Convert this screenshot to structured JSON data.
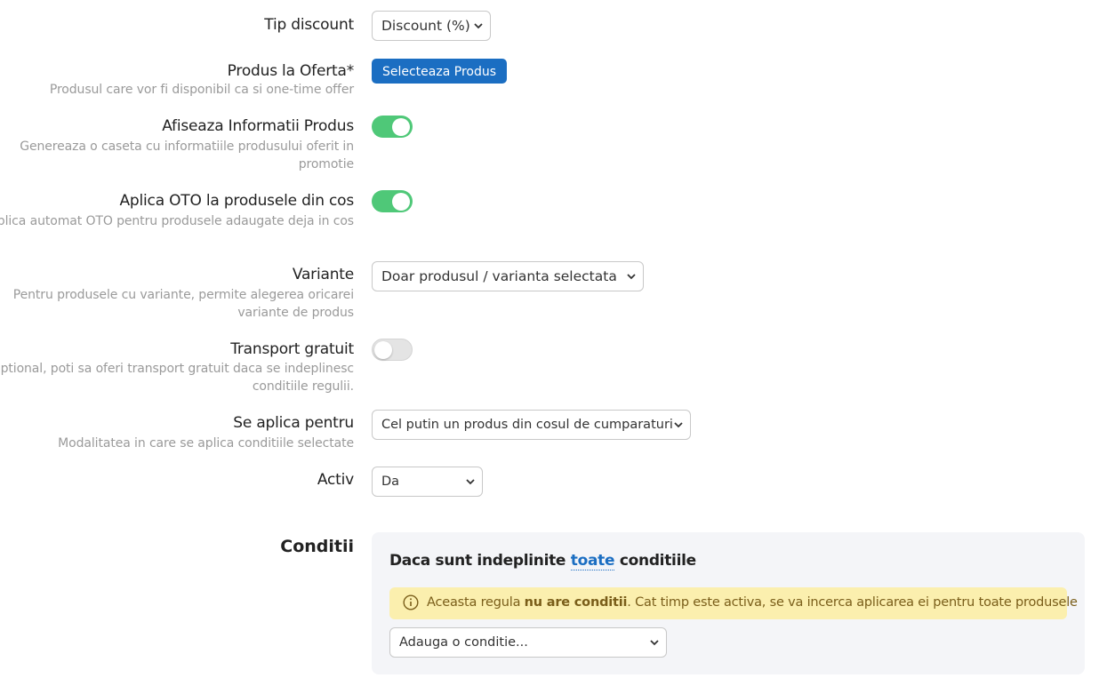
{
  "form": {
    "tip_discount": {
      "label": "Tip discount",
      "value": "Discount (%)"
    },
    "produs_oferta": {
      "label": "Produs la Oferta*",
      "help": "Produsul care vor fi disponibil ca si one-time offer",
      "button": "Selecteaza Produs"
    },
    "afiseaza_info": {
      "label": "Afiseaza Informatii Produs",
      "help": "Genereaza o caseta cu informatiile produsului oferit in promotie",
      "enabled": true
    },
    "aplica_oto": {
      "label": "Aplica OTO la produsele din cos",
      "help": "Aplica automat OTO pentru produsele adaugate deja in cos",
      "enabled": true
    },
    "variante": {
      "label": "Variante",
      "help": "Pentru produsele cu variante, permite alegerea oricarei variante de produs",
      "value": "Doar produsul / varianta selectata"
    },
    "transport": {
      "label": "Transport gratuit",
      "help": "Optional, poti sa oferi transport gratuit daca se indeplinesc conditiile regulii.",
      "enabled": false
    },
    "se_aplica": {
      "label": "Se aplica pentru",
      "help": "Modalitatea in care se aplica conditiile selectate",
      "value": "Cel putin un produs din cosul de cumparaturi"
    },
    "activ": {
      "label": "Activ",
      "value": "Da"
    }
  },
  "conditii": {
    "section_label": "Conditii",
    "title_prefix": "Daca sunt indeplinite",
    "title_link": "toate",
    "title_suffix": "conditiile",
    "alert_prefix": "Aceasta regula",
    "alert_bold": "nu are conditii",
    "alert_suffix": ". Cat timp este activa, se va incerca aplicarea ei pentru toate produsele",
    "add_condition": "Adauga o conditie..."
  },
  "colors": {
    "primary": "#1b6ec2",
    "toggle_on": "#4fc878",
    "alert_bg": "#fbefae",
    "panel_bg": "#f4f5f8"
  },
  "icons": {
    "select": "chevron-down-icon",
    "alert": "info-circle-icon"
  }
}
